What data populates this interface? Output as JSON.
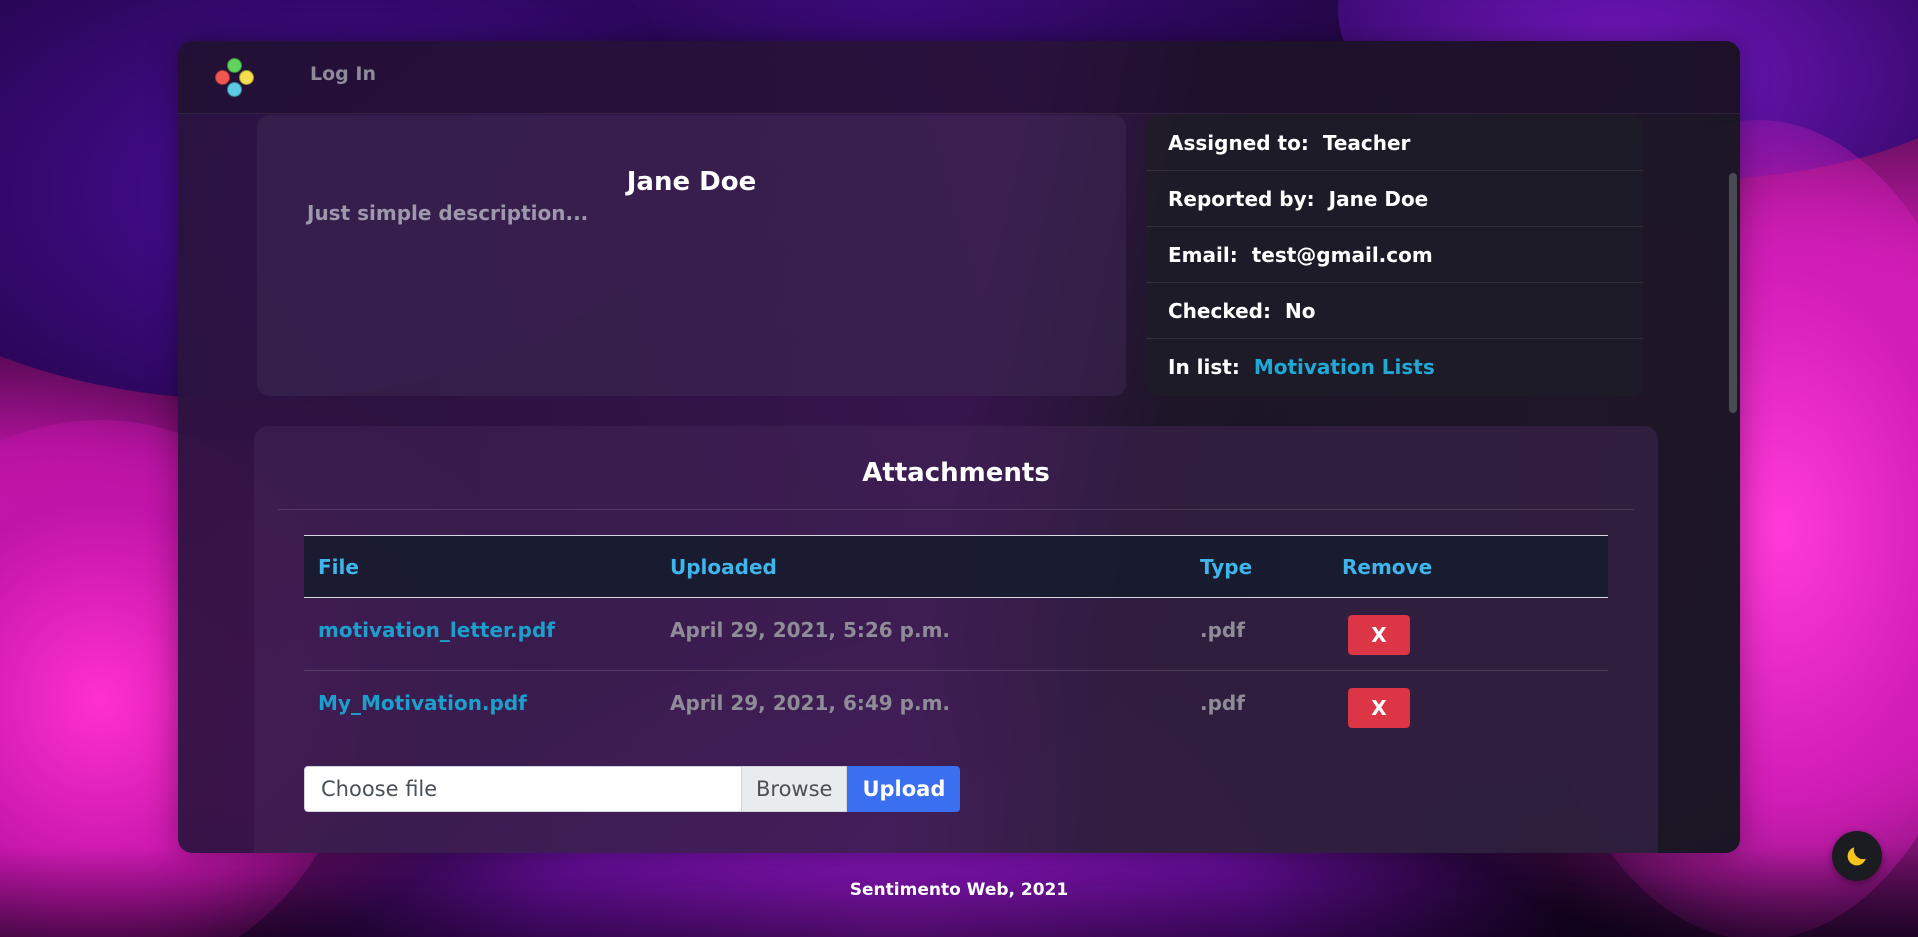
{
  "nav": {
    "login_label": "Log In"
  },
  "profile": {
    "name": "Jane Doe",
    "description": "Just simple description..."
  },
  "details": [
    {
      "label": "Assigned to:",
      "value": "Teacher"
    },
    {
      "label": "Reported by:",
      "value": "Jane Doe"
    },
    {
      "label": "Email:",
      "value": "test@gmail.com"
    },
    {
      "label": "Checked:",
      "value": "No"
    },
    {
      "label": "In list:",
      "value": "Motivation Lists"
    }
  ],
  "attachments": {
    "title": "Attachments",
    "columns": [
      "File",
      "Uploaded",
      "Type",
      "Remove"
    ],
    "rows": [
      {
        "file": "motivation_letter.pdf",
        "uploaded": "April 29, 2021, 5:26 p.m.",
        "type": ".pdf",
        "remove_label": "X"
      },
      {
        "file": "My_Motivation.pdf",
        "uploaded": "April 29, 2021, 6:49 p.m.",
        "type": ".pdf",
        "remove_label": "X"
      }
    ],
    "file_input_placeholder": "Choose file",
    "browse_label": "Browse",
    "upload_label": "Upload"
  },
  "footer": {
    "text": "Sentimento Web, 2021"
  },
  "colors": {
    "link": "#1fa9d6",
    "header_text": "#3fb5ec",
    "danger": "#dc3545",
    "primary": "#3a6ff0"
  },
  "icons": {
    "logo": "emoji-faces-logo-icon",
    "theme": "moon-icon"
  }
}
